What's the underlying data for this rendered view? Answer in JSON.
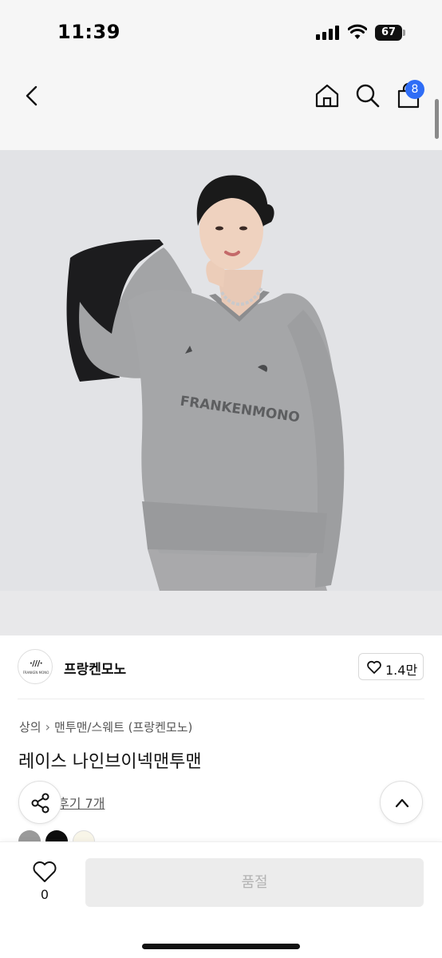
{
  "status": {
    "time": "11:39",
    "battery": "67"
  },
  "nav": {
    "cart_badge": "8",
    "icons": [
      "chevron-left-icon",
      "home-icon",
      "search-icon",
      "cart-icon"
    ]
  },
  "product_image": {
    "print_text": "FRANKENMONO",
    "alt": "product photo"
  },
  "brand": {
    "logo_text": "·///·",
    "logo_sub": "FRANKEN MONO",
    "name": "프랑켄모노",
    "likes": "1.4만"
  },
  "breadcrumb": {
    "category": "상의",
    "subcategory": "맨투맨/스웨트 (프랑켄모노)"
  },
  "product": {
    "title": "레이스 나인브이넥맨투맨"
  },
  "reviews": {
    "link_text": "후기 7개"
  },
  "colors": {
    "swatches": [
      "#9a9a9a",
      "#0d0d0d",
      "#f8f5e8"
    ]
  },
  "bottom_bar": {
    "wish_count": "0",
    "soldout_label": "품절"
  },
  "accent": "#2f6df6"
}
